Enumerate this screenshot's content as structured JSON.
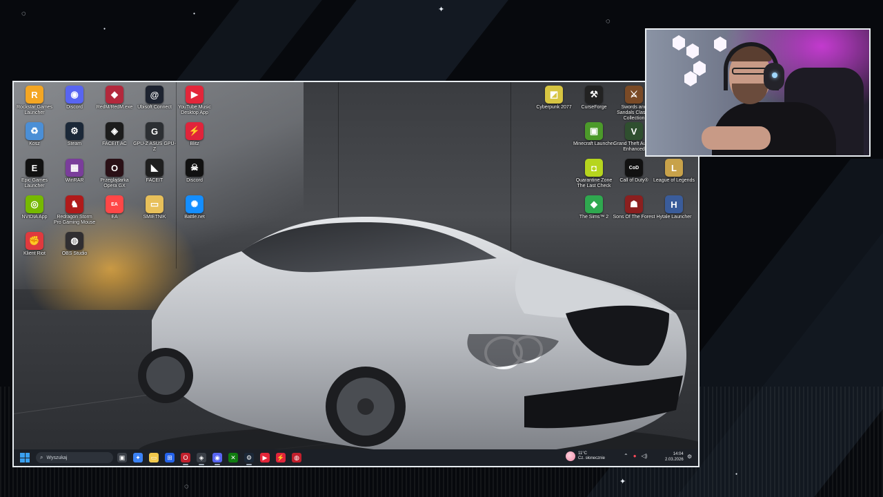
{
  "desktop": {
    "icons_left": [
      {
        "label": "Rockstar Games Launcher",
        "icon": "rockstar-icon",
        "color": "#f4a623",
        "glyph": "R"
      },
      {
        "label": "Discord",
        "icon": "discord-icon",
        "color": "#5865f2",
        "glyph": "◉"
      },
      {
        "label": "RedM/RedM.exe",
        "icon": "redm-icon",
        "color": "#b3283c",
        "glyph": "◆"
      },
      {
        "label": "Ubisoft Connect",
        "icon": "ubisoft-icon",
        "color": "#1d2330",
        "glyph": "@"
      },
      {
        "label": "YouTube Music Desktop App",
        "icon": "youtube-music-icon",
        "color": "#e3263a",
        "glyph": "▶"
      },
      {
        "label": "Kosz",
        "icon": "recycle-bin-icon",
        "color": "#4b8fd6",
        "glyph": "♻"
      },
      {
        "label": "Steam",
        "icon": "steam-icon",
        "color": "#1b2838",
        "glyph": "⚙"
      },
      {
        "label": "FACEIT AC",
        "icon": "faceit-ac-icon",
        "color": "#1c1c1c",
        "glyph": "◈"
      },
      {
        "label": "GPU-Z ASUS GPU-Z",
        "icon": "gpuz-icon",
        "color": "#2c2f33",
        "glyph": "G"
      },
      {
        "label": "Blitz",
        "icon": "blitz-icon",
        "color": "#e0243b",
        "glyph": "⚡"
      },
      {
        "label": "Epic Games Launcher",
        "icon": "epic-games-icon",
        "color": "#111111",
        "glyph": "E"
      },
      {
        "label": "WinRAR",
        "icon": "winrar-icon",
        "color": "#7a3d9b",
        "glyph": "▦"
      },
      {
        "label": "Przeglądarka Opera GX",
        "icon": "opera-gx-icon",
        "color": "#2a1016",
        "glyph": "O"
      },
      {
        "label": "FACEIT",
        "icon": "faceit-icon",
        "color": "#1f1f1f",
        "glyph": "◣"
      },
      {
        "label": "Discord",
        "icon": "discord-skull-icon",
        "color": "#111111",
        "glyph": "☠"
      },
      {
        "label": "NVIDIA App",
        "icon": "nvidia-icon",
        "color": "#76b900",
        "glyph": "◎"
      },
      {
        "label": "Redragon Storm Pro Gaming Mouse",
        "icon": "redragon-icon",
        "color": "#b01a1a",
        "glyph": "♞"
      },
      {
        "label": "EA",
        "icon": "ea-icon",
        "color": "#ff4747",
        "glyph": "EA"
      },
      {
        "label": "SMIETNIK",
        "icon": "folder-icon",
        "color": "#e8c05a",
        "glyph": "▭"
      },
      {
        "label": "Battle.net",
        "icon": "battlenet-icon",
        "color": "#148eff",
        "glyph": "✺"
      },
      {
        "label": "Klient Riot",
        "icon": "riot-client-icon",
        "color": "#e03a3e",
        "glyph": "✊"
      },
      {
        "label": "OBS Studio",
        "icon": "obs-icon",
        "color": "#302e31",
        "glyph": "◍"
      }
    ],
    "icons_right": [
      {
        "label": "Cyberpunk 2077",
        "icon": "cyberpunk-icon",
        "color": "#d7c542",
        "glyph": "◩"
      },
      {
        "label": "CurseForge",
        "icon": "curseforge-icon",
        "color": "#222222",
        "glyph": "⚒"
      },
      {
        "label": "Swords and Sandals Classic Collection",
        "icon": "swords-sandals-icon",
        "color": "#7a4a26",
        "glyph": "⚔"
      },
      {
        "label": "Minecraft Launcher",
        "icon": "minecraft-icon",
        "color": "#4c9a2a",
        "glyph": "▣"
      },
      {
        "label": "Grand Theft Auto V Enhanced",
        "icon": "gta-v-icon",
        "color": "#2f4f2f",
        "glyph": "V"
      },
      {
        "label": "Quarantine Zone The Last Check",
        "icon": "quarantine-zone-icon",
        "color": "#b6d51e",
        "glyph": "◘"
      },
      {
        "label": "Call of Duty®",
        "icon": "call-of-duty-icon",
        "color": "#111111",
        "glyph": "CoD"
      },
      {
        "label": "League of Legends",
        "icon": "league-of-legends-icon",
        "color": "#c8a24a",
        "glyph": "L"
      },
      {
        "label": "The Sims™ 2",
        "icon": "sims-icon",
        "color": "#2fa84f",
        "glyph": "◆"
      },
      {
        "label": "Sons Of The Forest",
        "icon": "sons-of-the-forest-icon",
        "color": "#8b1f1f",
        "glyph": "☗"
      },
      {
        "label": "Hytale Launcher",
        "icon": "hytale-icon",
        "color": "#3a5c9a",
        "glyph": "H"
      }
    ]
  },
  "taskbar": {
    "search_label": "Wyszukaj",
    "apps": [
      {
        "icon": "task-view-icon",
        "color": "#3b4048",
        "glyph": "▣"
      },
      {
        "icon": "copilot-icon",
        "color": "#3b82f6",
        "glyph": "✦"
      },
      {
        "icon": "file-explorer-icon",
        "color": "#f2c94c",
        "glyph": "▭"
      },
      {
        "icon": "microsoft-store-icon",
        "color": "#2563eb",
        "glyph": "⊞"
      },
      {
        "icon": "opera-gx-taskbar-icon",
        "color": "#c2202d",
        "glyph": "O"
      },
      {
        "icon": "app-taskbar-icon",
        "color": "#3a3f47",
        "glyph": "◈"
      },
      {
        "icon": "discord-taskbar-icon",
        "color": "#5865f2",
        "glyph": "◉"
      },
      {
        "icon": "xbox-icon",
        "color": "#107c10",
        "glyph": "✕"
      },
      {
        "icon": "steam-taskbar-icon",
        "color": "#1b2838",
        "glyph": "⚙"
      },
      {
        "icon": "youtube-music-taskbar-icon",
        "color": "#e3263a",
        "glyph": "▶"
      },
      {
        "icon": "blitz-taskbar-icon",
        "color": "#e0243b",
        "glyph": "⚡"
      },
      {
        "icon": "obs-taskbar-icon",
        "color": "#c2202d",
        "glyph": "◍"
      }
    ],
    "weather_temp": "11°C",
    "weather_desc": "Cz. słonecznie",
    "time": "14:04",
    "date": "2.03.2026"
  },
  "colors": {
    "overlay_bg": "#07090d",
    "frame_border": "#e9eef2",
    "taskbar": "#1c2027",
    "accent": "#3aa0f0"
  }
}
